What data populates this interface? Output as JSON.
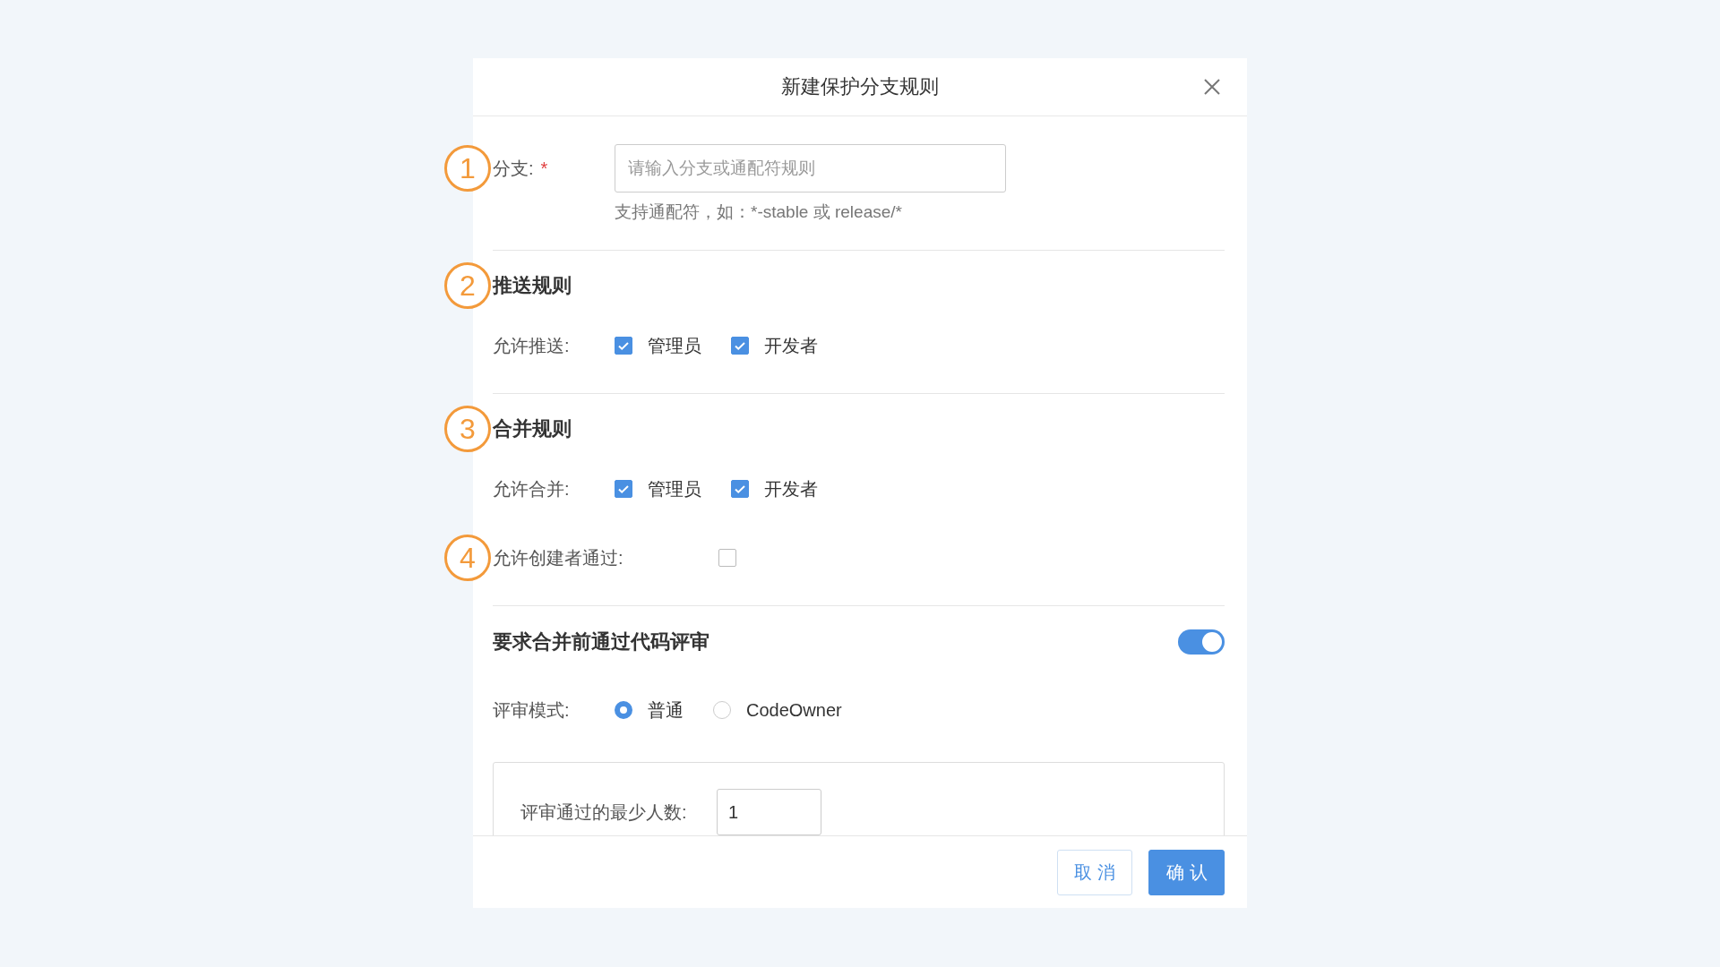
{
  "dialog": {
    "title": "新建保护分支规则"
  },
  "branch": {
    "marker": "1",
    "label": "分支:",
    "required_mark": "*",
    "placeholder": "请输入分支或通配符规则",
    "hint": "支持通配符，如：*-stable 或 release/*"
  },
  "push_rules": {
    "marker": "2",
    "heading": "推送规则",
    "label": "允许推送:",
    "options": [
      {
        "label": "管理员",
        "checked": true
      },
      {
        "label": "开发者",
        "checked": true
      }
    ]
  },
  "merge_rules": {
    "marker": "3",
    "heading": "合并规则",
    "label": "允许合并:",
    "options": [
      {
        "label": "管理员",
        "checked": true
      },
      {
        "label": "开发者",
        "checked": true
      }
    ],
    "creator": {
      "marker": "4",
      "label": "允许创建者通过:",
      "checked": false
    }
  },
  "code_review": {
    "heading": "要求合并前通过代码评审",
    "on": true,
    "mode_label": "评审模式:",
    "modes": [
      {
        "label": "普通",
        "selected": true
      },
      {
        "label": "CodeOwner",
        "selected": false
      }
    ],
    "min_label": "评审通过的最少人数:",
    "min_value": "1"
  },
  "buttons": [
    {
      "label": "取消",
      "kind": "secondary"
    },
    {
      "label": "确认",
      "kind": "primary"
    }
  ]
}
